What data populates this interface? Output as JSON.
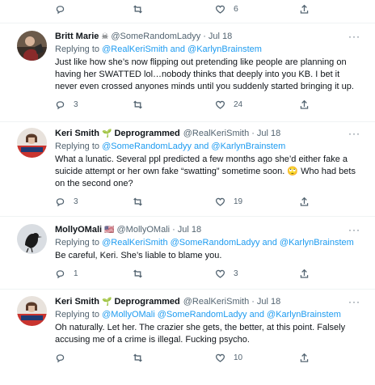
{
  "top_actions": {
    "reply": "",
    "retweet": "",
    "like": "6",
    "share": ""
  },
  "tweets": [
    {
      "name": "Britt Marie",
      "badge": "☠",
      "handle": "@SomeRandomLadyy",
      "time": "Jul 18",
      "replying_prefix": "Replying to",
      "replying_to": "@RealKeriSmith and @KarlynBrainstem",
      "text": "Just like how she’s now flipping out pretending like people are planning on having her SWATTED lol…nobody thinks that deeply into you KB. I bet it never even crossed anyones minds until you suddenly started bringing it up.",
      "replies": "3",
      "retweets": "",
      "likes": "24"
    },
    {
      "name": "Keri Smith",
      "badge": "🌱",
      "badge_suffix": "Deprogrammed",
      "handle": "@RealKeriSmith",
      "time": "Jul 18",
      "replying_prefix": "Replying to",
      "replying_to": "@SomeRandomLadyy and @KarlynBrainstem",
      "text": "What a lunatic. Several ppl predicted a few months ago she’d either fake a suicide attempt or her own fake “swatting” sometime soon. 🙄 Who had bets on the second one?",
      "replies": "3",
      "retweets": "",
      "likes": "19"
    },
    {
      "name": "MollyOMali",
      "badge": "🇺🇸",
      "handle": "@MollyOMali",
      "time": "Jul 18",
      "replying_prefix": "Replying to",
      "replying_to": "@RealKeriSmith @SomeRandomLadyy and @KarlynBrainstem",
      "text": "Be careful, Keri. She’s liable to blame you.",
      "replies": "1",
      "retweets": "",
      "likes": "3"
    },
    {
      "name": "Keri Smith",
      "badge": "🌱",
      "badge_suffix": "Deprogrammed",
      "handle": "@RealKeriSmith",
      "time": "Jul 18",
      "replying_prefix": "Replying to",
      "replying_to": "@MollyOMali @SomeRandomLadyy and @KarlynBrainstem",
      "text": "Oh naturally. Let her. The crazier she gets, the better, at this point. Falsely accusing me of a crime is illegal. Fucking psycho.",
      "replies": "",
      "retweets": "",
      "likes": "10"
    }
  ],
  "icons": {
    "reply": "reply-icon",
    "retweet": "retweet-icon",
    "like": "heart-icon",
    "share": "share-icon",
    "more": "more-icon"
  },
  "colors": {
    "link": "#1d9bf0",
    "muted": "#536471",
    "text": "#0f1419",
    "divider": "#eff3f4"
  }
}
